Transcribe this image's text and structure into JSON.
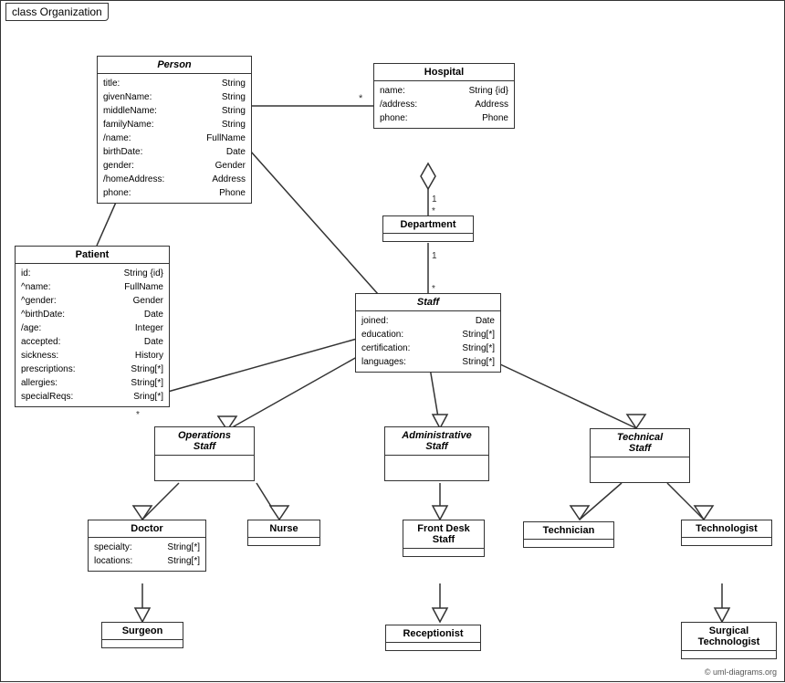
{
  "diagram": {
    "title": "class Organization",
    "copyright": "© uml-diagrams.org",
    "classes": {
      "person": {
        "name": "Person",
        "italic": true,
        "attrs": [
          {
            "name": "title:",
            "type": "String"
          },
          {
            "name": "givenName:",
            "type": "String"
          },
          {
            "name": "middleName:",
            "type": "String"
          },
          {
            "name": "familyName:",
            "type": "String"
          },
          {
            "name": "/name:",
            "type": "FullName"
          },
          {
            "name": "birthDate:",
            "type": "Date"
          },
          {
            "name": "gender:",
            "type": "Gender"
          },
          {
            "name": "/homeAddress:",
            "type": "Address"
          },
          {
            "name": "phone:",
            "type": "Phone"
          }
        ]
      },
      "hospital": {
        "name": "Hospital",
        "italic": false,
        "attrs": [
          {
            "name": "name:",
            "type": "String {id}"
          },
          {
            "name": "/address:",
            "type": "Address"
          },
          {
            "name": "phone:",
            "type": "Phone"
          }
        ]
      },
      "department": {
        "name": "Department",
        "italic": false,
        "attrs": []
      },
      "staff": {
        "name": "Staff",
        "italic": true,
        "attrs": [
          {
            "name": "joined:",
            "type": "Date"
          },
          {
            "name": "education:",
            "type": "String[*]"
          },
          {
            "name": "certification:",
            "type": "String[*]"
          },
          {
            "name": "languages:",
            "type": "String[*]"
          }
        ]
      },
      "patient": {
        "name": "Patient",
        "italic": false,
        "attrs": [
          {
            "name": "id:",
            "type": "String {id}"
          },
          {
            "name": "^name:",
            "type": "FullName"
          },
          {
            "name": "^gender:",
            "type": "Gender"
          },
          {
            "name": "^birthDate:",
            "type": "Date"
          },
          {
            "name": "/age:",
            "type": "Integer"
          },
          {
            "name": "accepted:",
            "type": "Date"
          },
          {
            "name": "sickness:",
            "type": "History"
          },
          {
            "name": "prescriptions:",
            "type": "String[*]"
          },
          {
            "name": "allergies:",
            "type": "String[*]"
          },
          {
            "name": "specialReqs:",
            "type": "Sring[*]"
          }
        ]
      },
      "operations_staff": {
        "name": "Operations Staff",
        "italic": true
      },
      "administrative_staff": {
        "name": "Administrative Staff",
        "italic": true
      },
      "technical_staff": {
        "name": "Technical Staff",
        "italic": true
      },
      "doctor": {
        "name": "Doctor",
        "italic": false,
        "attrs": [
          {
            "name": "specialty:",
            "type": "String[*]"
          },
          {
            "name": "locations:",
            "type": "String[*]"
          }
        ]
      },
      "nurse": {
        "name": "Nurse",
        "italic": false,
        "attrs": []
      },
      "front_desk_staff": {
        "name": "Front Desk Staff",
        "italic": false,
        "attrs": []
      },
      "technician": {
        "name": "Technician",
        "italic": false,
        "attrs": []
      },
      "technologist": {
        "name": "Technologist",
        "italic": false,
        "attrs": []
      },
      "surgeon": {
        "name": "Surgeon",
        "italic": false,
        "attrs": []
      },
      "receptionist": {
        "name": "Receptionist",
        "italic": false,
        "attrs": []
      },
      "surgical_technologist": {
        "name": "Surgical Technologist",
        "italic": false,
        "attrs": []
      }
    }
  }
}
